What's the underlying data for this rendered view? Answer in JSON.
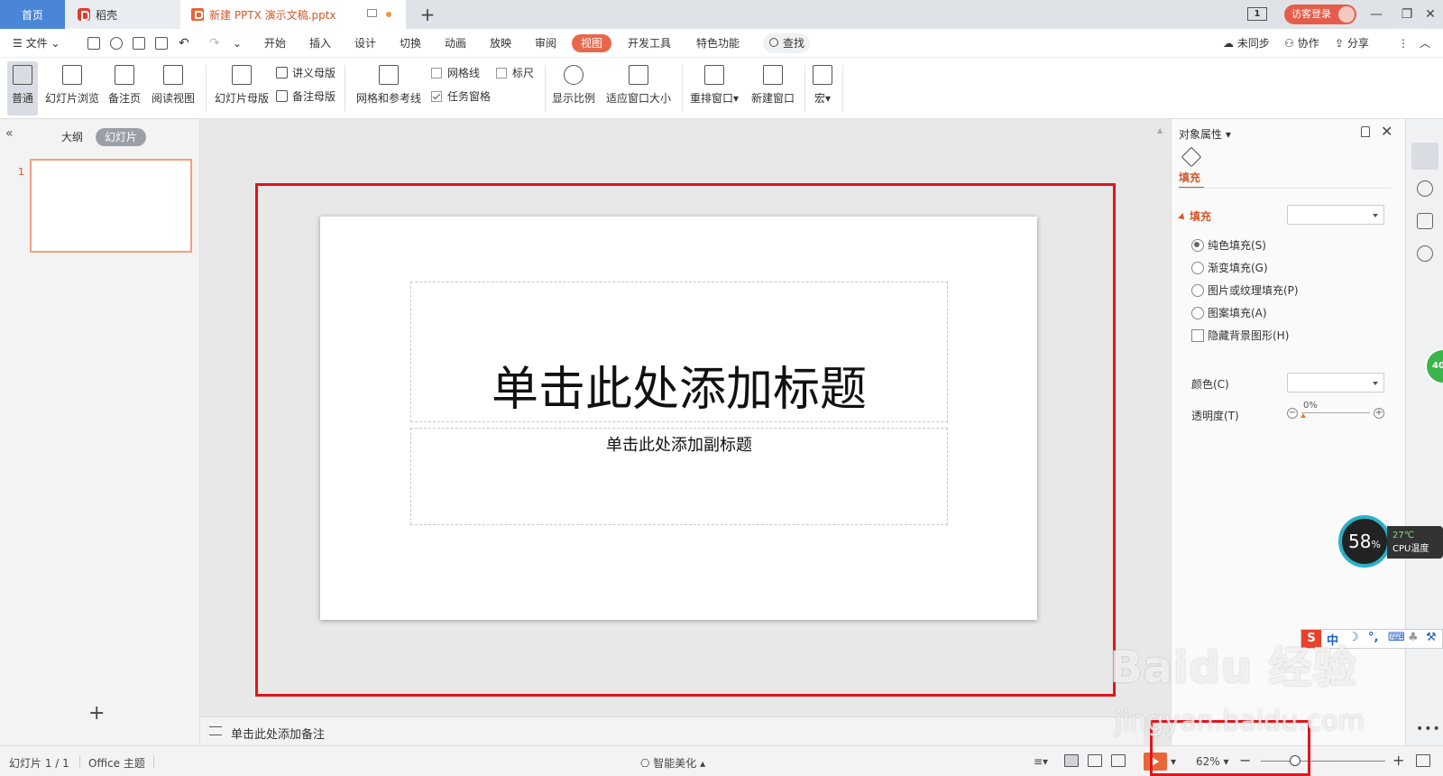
{
  "tabs": {
    "home": "首页",
    "daoke": "稻壳",
    "document": "新建 PPTX 演示文稿.pptx",
    "window_count": "1",
    "login": "访客登录"
  },
  "menubar": {
    "file": "文件",
    "items": [
      "开始",
      "插入",
      "设计",
      "切换",
      "动画",
      "放映",
      "审阅",
      "视图",
      "开发工具",
      "特色功能"
    ],
    "search": "查找",
    "sync": "未同步",
    "collab": "协作",
    "share": "分享"
  },
  "ribbon": {
    "normal": "普通",
    "slide_sorter": "幻灯片浏览",
    "notes_page": "备注页",
    "reading_view": "阅读视图",
    "slide_master": "幻灯片母版",
    "handout_master": "讲义母版",
    "notes_master": "备注母版",
    "grid_guides": "网格和参考线",
    "gridlines": "网格线",
    "ruler": "标尺",
    "task_pane": "任务窗格",
    "zoom": "显示比例",
    "fit_window": "适应窗口大小",
    "arrange": "重排窗口",
    "new_window": "新建窗口",
    "macro": "宏"
  },
  "leftpanel": {
    "outline": "大纲",
    "slides": "幻灯片",
    "slide_number": "1"
  },
  "slide": {
    "title": "单击此处添加标题",
    "subtitle": "单击此处添加副标题"
  },
  "notes": {
    "placeholder": "单击此处添加备注"
  },
  "properties": {
    "title": "对象属性",
    "fill_tab": "填充",
    "fill_section": "填充",
    "options": [
      "纯色填充(S)",
      "渐变填充(G)",
      "图片或纹理填充(P)",
      "图案填充(A)"
    ],
    "hide_bg": "隐藏背景图形(H)",
    "color": "颜色(C)",
    "transparency": "透明度(T)",
    "transparency_value": "0%"
  },
  "statusbar": {
    "slide_info": "幻灯片 1 / 1",
    "theme": "Office 主题",
    "beautify": "智能美化",
    "zoom": "62%"
  },
  "widgets": {
    "cpu_percent": "58",
    "cpu_percent_unit": "%",
    "cpu_temp": "27℃",
    "cpu_label": "CPU温度",
    "green_badge": "40",
    "ime": [
      "中",
      "☽",
      "°,",
      "⌨",
      "♣",
      "⚒"
    ]
  },
  "watermark": {
    "line1": "Baidu 经验",
    "line2": "jingyan.baidu.com"
  }
}
